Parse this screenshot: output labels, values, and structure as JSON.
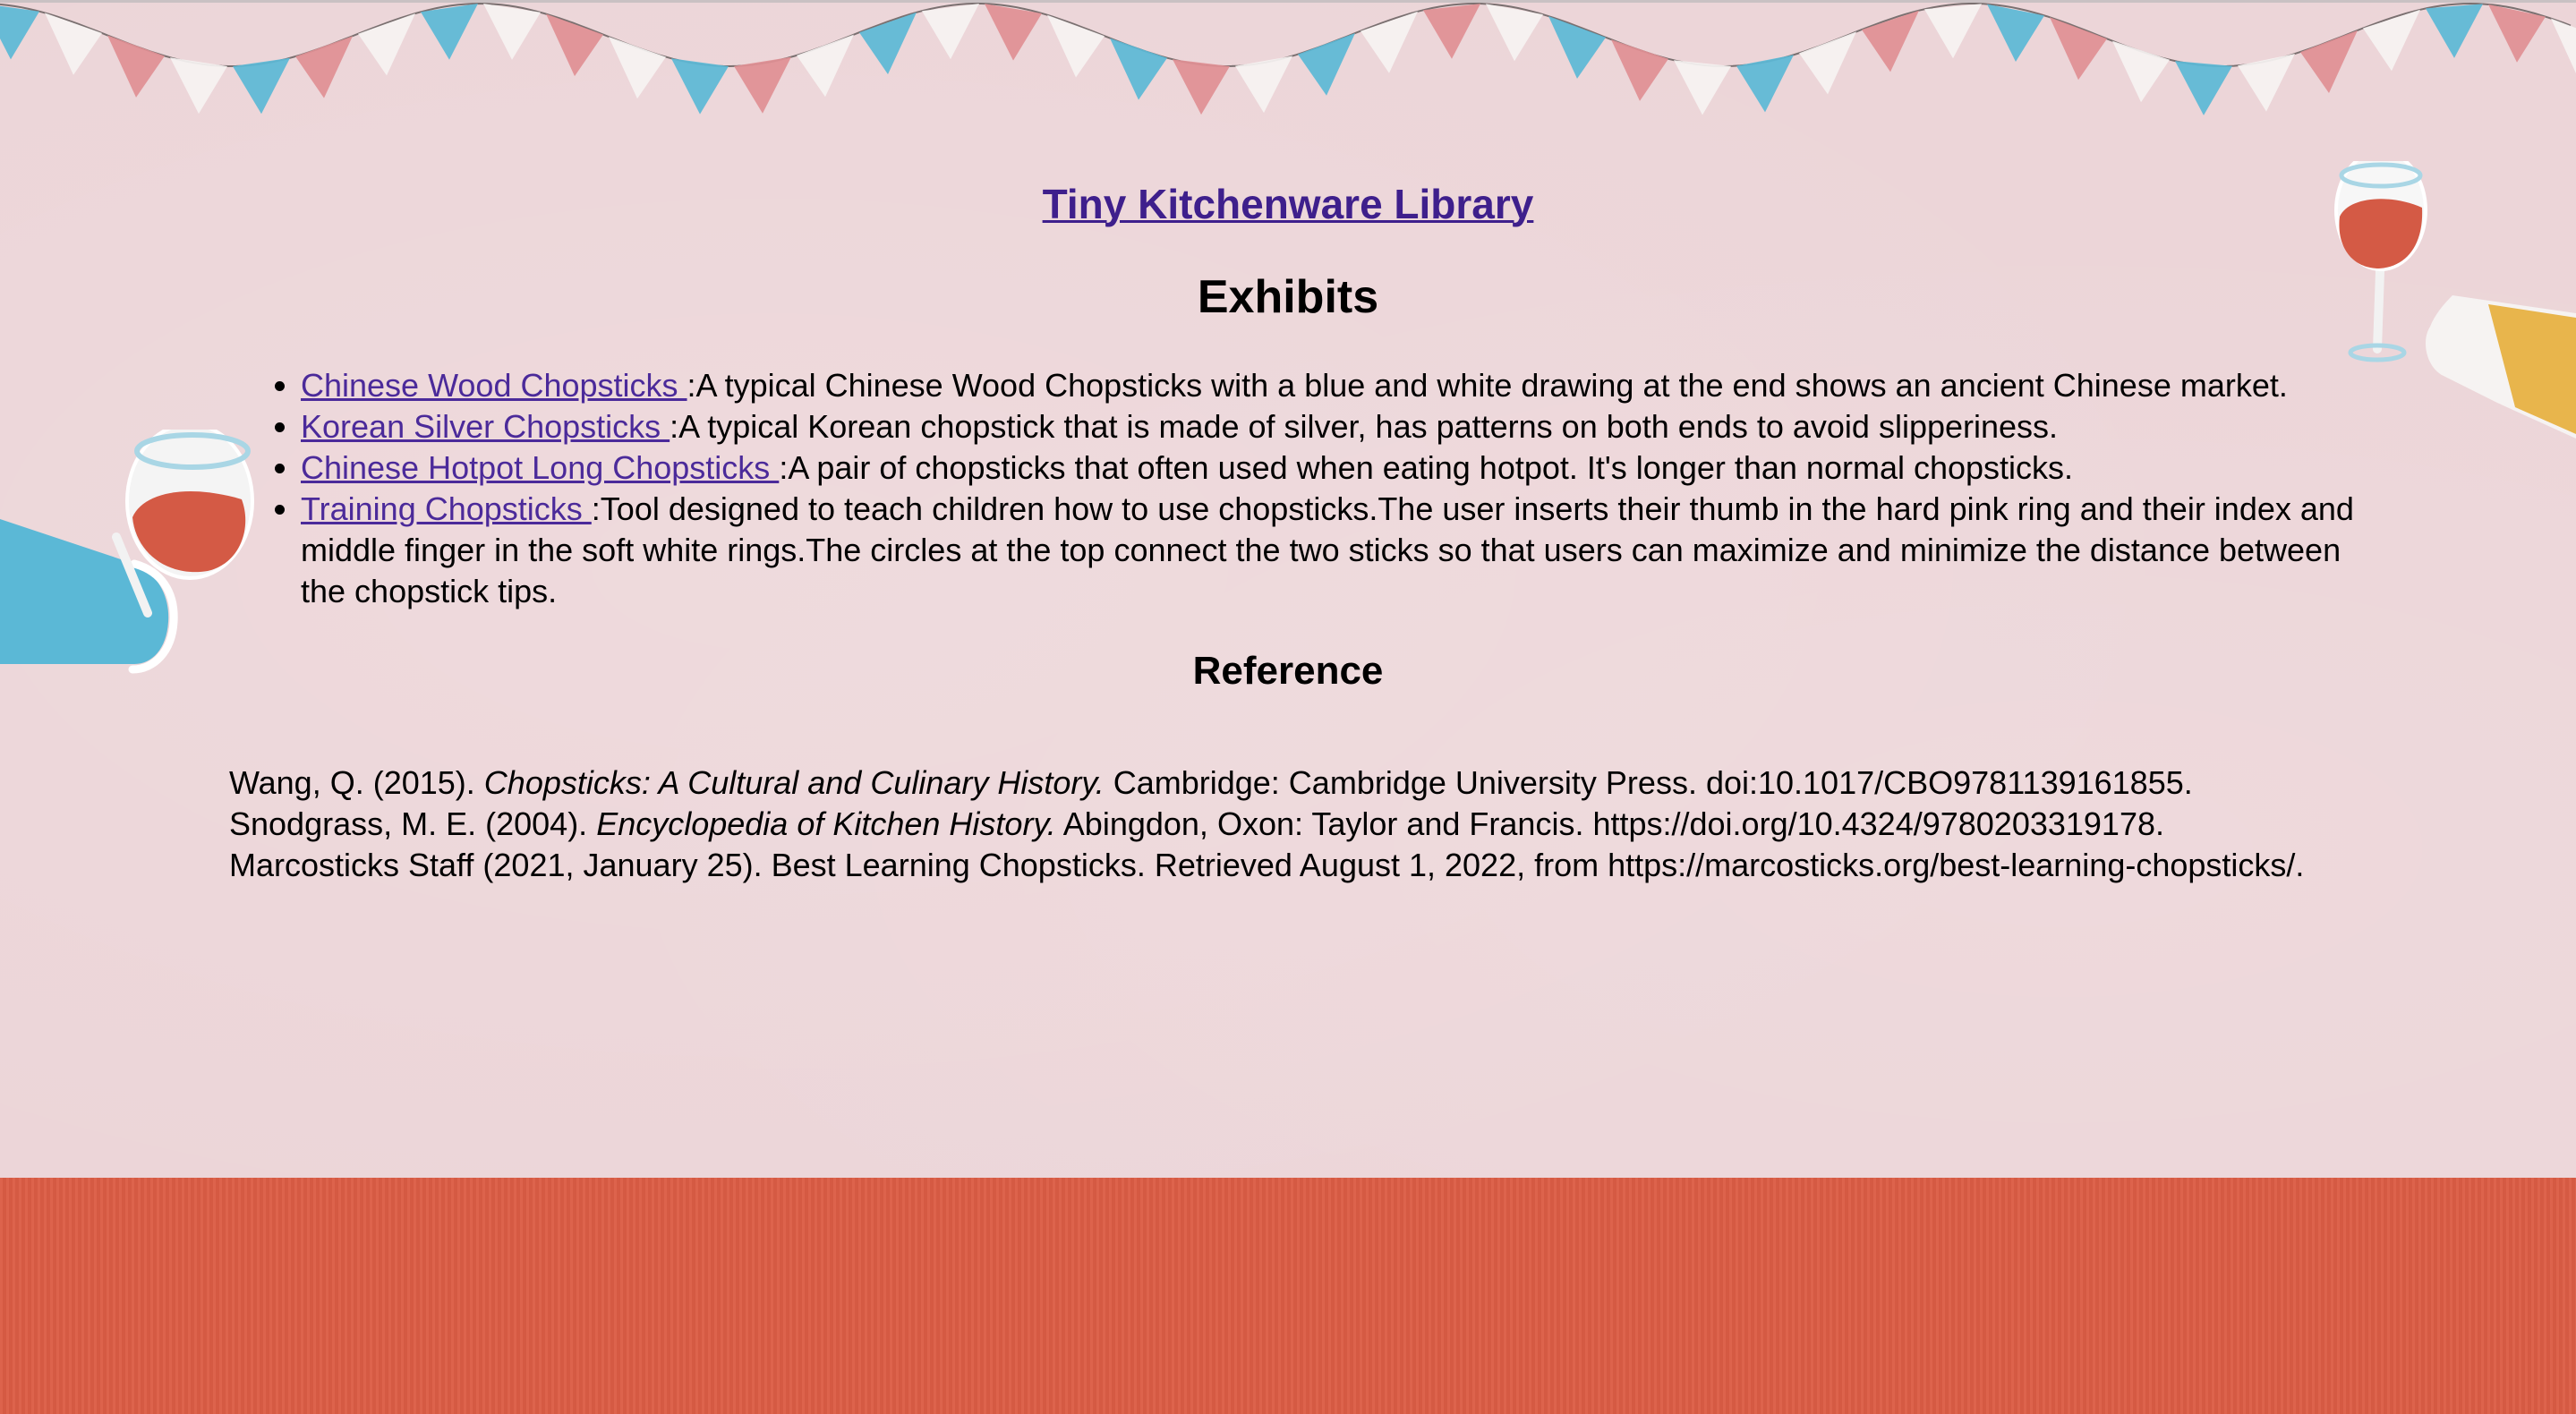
{
  "site": {
    "title": "Tiny Kitchenware Library"
  },
  "exhibits": {
    "heading": "Exhibits",
    "items": [
      {
        "link": "Chinese Wood Chopsticks ",
        "description": ":A typical Chinese Wood Chopsticks with a blue and white drawing at the end shows an ancient Chinese market."
      },
      {
        "link": "Korean Silver Chopsticks ",
        "description": ":A typical Korean chopstick that is made of silver, has patterns on both ends to avoid slipperiness."
      },
      {
        "link": "Chinese Hotpot Long Chopsticks ",
        "description": ":A pair of chopsticks that often used when eating hotpot. It's longer than normal chopsticks."
      },
      {
        "link": "Training Chopsticks ",
        "description": ":Tool designed to teach children how to use chopsticks.The user inserts their thumb in the hard pink ring and their index and middle finger in the soft white rings.The circles at the top connect the two sticks so that users can maximize and minimize the distance between the chopstick tips."
      }
    ]
  },
  "reference": {
    "heading": "Reference",
    "entries": [
      {
        "prefix": "Wang, Q. (2015). ",
        "title": "Chopsticks: A Cultural and Culinary History.",
        "suffix": " Cambridge: Cambridge University Press. doi:10.1017/CBO9781139161855."
      },
      {
        "prefix": "Snodgrass, M. E. (2004). ",
        "title": "Encyclopedia of Kitchen History.",
        "suffix": " Abingdon, Oxon: Taylor and Francis. https://doi.org/10.4324/9780203319178."
      },
      {
        "prefix": "Marcosticks Staff (2021, January 25). Best Learning Chopsticks. Retrieved August 1, 2022, from https://marcosticks.org/best-learning-chopsticks/.",
        "title": "",
        "suffix": ""
      }
    ]
  },
  "colors": {
    "background": "#ecd5d8",
    "floor": "#dc5d45",
    "link": "#4b2a9a",
    "title_link": "#3e1f8c",
    "flag_blue": "#5bb8d6",
    "flag_pink": "#e08f94",
    "flag_white": "#f6f3f2",
    "wine": "#d45a45",
    "sleeve_blue": "#5bb8d6",
    "sleeve_yellow": "#e8b54c"
  },
  "decorations": {
    "bunting_icon": "bunting-flags-icon",
    "left_decor_icon": "hand-holding-wine-glass-icon",
    "right_decor_icon": "hand-holding-wine-glass-icon"
  }
}
